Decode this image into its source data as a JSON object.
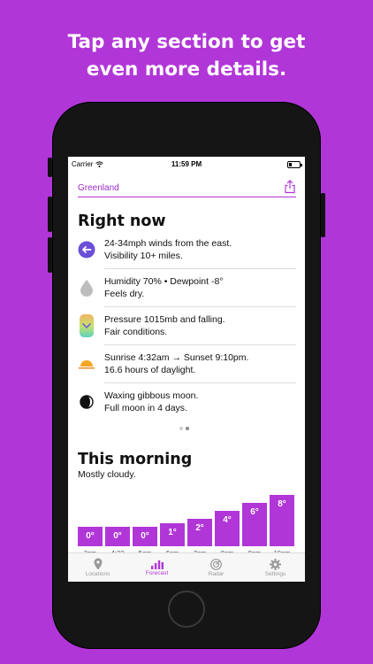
{
  "headline": {
    "line1": "Tap any section to get",
    "line2": "even more details."
  },
  "status": {
    "carrier": "Carrier",
    "time": "11:59 PM"
  },
  "location": {
    "name": "Greenland"
  },
  "right_now": {
    "title": "Right now",
    "rows": [
      {
        "icon": "wind-arrow-icon",
        "line1": "24-34mph winds from the east.",
        "line2": "Visibility 10+ miles."
      },
      {
        "icon": "humidity-drop-icon",
        "line1": "Humidity 70% • Dewpoint -8°",
        "line2": "Feels dry."
      },
      {
        "icon": "pressure-gauge-icon",
        "line1": "Pressure 1015mb and falling.",
        "line2": "Fair conditions."
      },
      {
        "icon": "sunrise-icon",
        "line1": "Sunrise 4:32am → Sunset 9:10pm.",
        "line2": "16.6 hours of daylight."
      },
      {
        "icon": "moon-phase-icon",
        "line1": "Waxing gibbous moon.",
        "line2": "Full moon in 4 days."
      }
    ]
  },
  "morning": {
    "title": "This morning",
    "summary": "Mostly cloudy.",
    "temps": [
      "0°",
      "0°",
      "0°",
      "1°",
      "2°",
      "4°",
      "6°",
      "8°"
    ],
    "temp_values": [
      0,
      0,
      0,
      1,
      2,
      4,
      6,
      8
    ],
    "hours": [
      "3am",
      "4:32",
      "5am",
      "6am",
      "7am",
      "8am",
      "9am",
      "10am"
    ]
  },
  "tabs": [
    {
      "label": "Locations",
      "icon": "location-pin-icon"
    },
    {
      "label": "Forecast",
      "icon": "bar-chart-icon"
    },
    {
      "label": "Radar",
      "icon": "radar-icon"
    },
    {
      "label": "Settings",
      "icon": "gear-icon"
    }
  ],
  "colors": {
    "accent": "#b136d8",
    "wind_icon": "#6b4fd8",
    "tab_active": "#b136d8"
  }
}
